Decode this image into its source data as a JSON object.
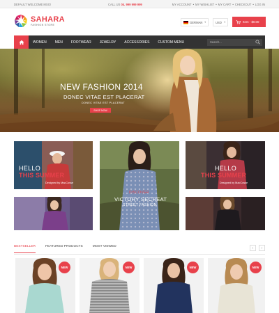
{
  "topbar": {
    "welcome": "DEFAULT WELCOME MSG!",
    "phone_prefix": "Call us",
    "phone_number": "04. 999 999 999",
    "links": [
      "MY ACCOUNT",
      "MY WISHLIST",
      "MY CART",
      "CHECKOUT",
      "LOG IN"
    ],
    "separator": "•"
  },
  "header": {
    "brand_name": "SAHARA",
    "brand_tagline": "FASHION STORE",
    "language": "GERMAN",
    "currency": "USD",
    "cart_label": "Item - $0.00"
  },
  "nav": {
    "items": [
      "WOMEN",
      "MEN",
      "FOOTWEAR",
      "JEWELRY",
      "ACCESSORIES",
      "CUSTOM MENU"
    ],
    "search_placeholder": "Search..."
  },
  "hero": {
    "title": "NEW FASHION 2014",
    "subtitle": "DONEC VITAE EST PLACERAT",
    "small_text": "DONEC VITAE EST PLACERAT",
    "button": "SHOP NOW"
  },
  "banners": {
    "left_top": {
      "line1": "HELLO",
      "line2": "THIS SUMMER",
      "line3": "Designed by MacCosse"
    },
    "center": {
      "line1": "DISCOVER",
      "line2": "VICTORY SECREAT",
      "line3": "STREET FASHION"
    },
    "right_top": {
      "line1": "HELLO",
      "line2": "THIS SUMMER",
      "line3": "Designed by MacCosse"
    }
  },
  "products": {
    "tabs": [
      "BESTSELLER",
      "FEATURED PRODUCTS",
      "MOST VIEWED"
    ],
    "active_tab": "BESTSELLER",
    "prev_icon": "‹",
    "next_icon": "›",
    "badge": "NEW"
  },
  "colors": {
    "accent": "#e8414b",
    "nav_bg": "#333333",
    "topbar_bg": "#f4f4f4"
  }
}
